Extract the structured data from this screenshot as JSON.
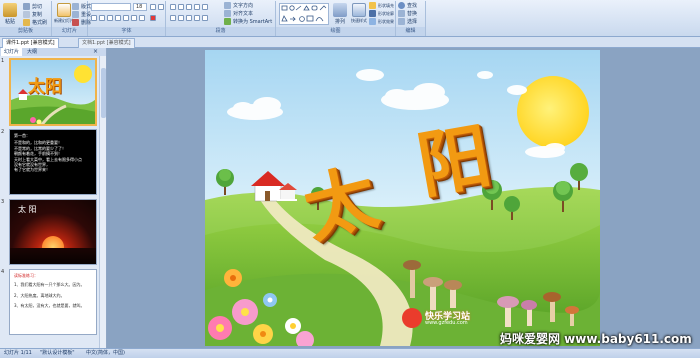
{
  "ribbon": {
    "clipboard": {
      "paste": "粘贴",
      "cut": "剪切",
      "copy": "复制",
      "format_painter": "格式刷",
      "label": "剪贴板"
    },
    "slides": {
      "new_slide": "新建幻灯片",
      "layout": "版式",
      "reset": "重设",
      "delete": "删除",
      "label": "幻灯片"
    },
    "font": {
      "name_value": "",
      "size_value": "18",
      "label": "字体"
    },
    "paragraph": {
      "text_direction": "文字方向",
      "align_text": "对齐文本",
      "smartart": "转换为 SmartArt",
      "label": "段落"
    },
    "drawing": {
      "arrange": "排列",
      "quick_styles": "快速样式",
      "shape_fill": "形状填充",
      "shape_outline": "形状轮廓",
      "shape_effects": "形状效果",
      "label": "绘图"
    },
    "editing": {
      "find": "查找",
      "replace": "替换",
      "select": "选择",
      "label": "编辑"
    }
  },
  "doc_tabs": [
    {
      "label": "课件1.ppt [兼容模式]"
    },
    {
      "label": "文档1.ppt [兼容模式]"
    }
  ],
  "pane_tabs": {
    "slides": "幻灯片",
    "outline": "大纲"
  },
  "thumbnails": [
    {
      "num": "1",
      "title": "太阳"
    },
    {
      "num": "2",
      "heading": "第一首：",
      "lines": [
        "不是和的，比和的更重要！",
        "不是常的，比常的要少了了！",
        "朝颜有着花，手前摘不到！",
        "天时上看大菜中，看上去有限多得小点",
        "没有它就没有世界，",
        "有了它就为世界来！"
      ]
    },
    {
      "num": "3",
      "title": "太 阳"
    },
    {
      "num": "4",
      "heading": "读标准练习：",
      "items": [
        "1、我们看大阳有一只个那么大。因为。",
        "2、大阳热度。离地球大约。",
        "3、有太阳，没有大，也就是要，就叫。"
      ]
    }
  ],
  "slide": {
    "title": "太阳",
    "logo_text": "快乐学习站",
    "logo_sub": "www.gzfedu.com"
  },
  "watermark": {
    "text": "妈咪爱婴网 www.baby611.com"
  },
  "statusbar": {
    "slide_info": "幻灯片 1/11",
    "theme": "\"默认设计模板\"",
    "lang": "中文(简体，中国)"
  },
  "colors": {
    "accent": "#f29a12",
    "sky_top": "#9dd1ef",
    "grass": "#6cb235",
    "ribbon_bg": "#dce7f6"
  }
}
